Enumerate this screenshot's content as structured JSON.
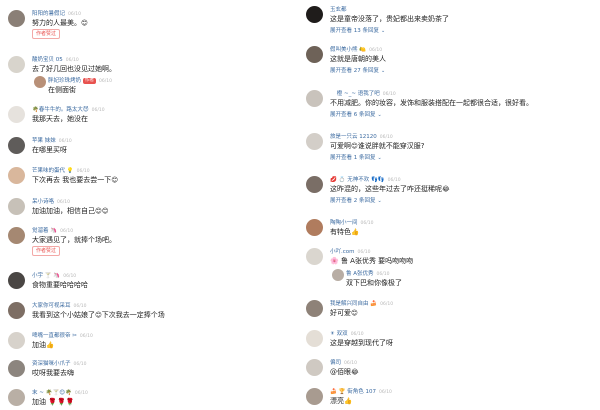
{
  "left": [
    {
      "name": "阳阳的暑假记",
      "time": "06/10",
      "text": "努力的人最美。",
      "emoji": "😊",
      "badge": "作者赞过",
      "avatar": "#8a7f76"
    },
    {
      "name": "酸奶宝贝 05",
      "time": "06/10",
      "text": "去了好几回也没见过她啊。",
      "avatar": "#d8d4cc",
      "reply": {
        "name": "胖妃珍珠烤奶",
        "tag": "作者",
        "time": "06/10",
        "text": "在侧面街",
        "avatar": "#b89078"
      }
    },
    {
      "name": "🌴春牛牛的。路太大😈",
      "time": "06/10",
      "text": "我那天去，她没在",
      "avatar": "#e6e2dd"
    },
    {
      "name": "苹果 妹妹",
      "time": "06/10",
      "text": "在哪里买呀",
      "avatar": "#5f5c5a"
    },
    {
      "name": "芒果味的蛋代 💡",
      "time": "06/10",
      "text": "下次再去 我也要去尝一下",
      "emoji": "😊",
      "avatar": "#d9b79c"
    },
    {
      "name": "呆小诗咯",
      "time": "06/10",
      "text": "加油加油，相信自己",
      "emoji": "😊😊",
      "avatar": "#c7c1b8"
    },
    {
      "name": "觉溜着 🦄",
      "time": "06/10",
      "text": "大家遇见了，就捧个场吧。",
      "badge": "作者赞过",
      "avatar": "#a58872"
    },
    {
      "name": "小宇 🍸 🦄",
      "time": "06/10",
      "text": "食物重要哈哈哈哈",
      "avatar": "#4a4644"
    },
    {
      "name": "大家你可视采耳",
      "time": "06/10",
      "text": "我看到这个小姑娘了",
      "emoji": "😊",
      "text2": "下次我去一定捧个场",
      "avatar": "#7d6e64"
    },
    {
      "name": "啤嘴一直都很帝 ✂",
      "time": "06/10",
      "text": "加油",
      "emoji": "👍",
      "avatar": "#d7d2cb"
    },
    {
      "name": "资深猫咪小爪子",
      "time": "06/10",
      "text": "哎呀我要去嗨",
      "avatar": "#8c857e"
    },
    {
      "name": "末 ~ 🌴🍸😊🌴",
      "time": "06/10",
      "text": "加油 🌹🌹🌹",
      "avatar": "#b9afa5"
    }
  ],
  "right": [
    {
      "name": "玉玄都",
      "time": "",
      "text": "这是童帝没落了，贵妃都出来卖奶茶了",
      "expand": "展开查看 13 条回复",
      "avatar": "#1f1c1b"
    },
    {
      "name": "假叫美小熊 🍋",
      "time": "06/10",
      "text": "这就是唐朝的美人",
      "expand": "展开查看 27 条回复",
      "avatar": "#6e6258"
    },
    {
      "name": "ㅤ 橙 ~_~ 语我了吧",
      "time": "06/10",
      "text": "不用减肥。你的妆容，发饰和服装搭配在一起都很合适，很好看。",
      "expand": "展开查看 6 条回复",
      "avatar": "#c9c3bc"
    },
    {
      "name": "旅是一只云 12120",
      "time": "06/10",
      "text": "可爱啊",
      "emoji": "😊",
      "text2": "谁说胖就不能穿汉服?",
      "expand": "展开查看 1 条回复",
      "avatar": "#d3cec8"
    },
    {
      "name": "💋 💍 无神不欢 👣👣",
      "time": "06/10",
      "text": "这昨混的，这些年过去了咋还挺稀呢",
      "emoji": "😂",
      "expand": "展开查看 2 条回复",
      "avatar": "#7a6e66"
    },
    {
      "name": "陶陶小一间",
      "time": "06/10",
      "text": "有特色",
      "emoji": "👍",
      "avatar": "#b07c5e"
    },
    {
      "name": "小吖.com",
      "time": "06/10",
      "text": "🌸 鲁 A张优秀  要吗吻吻吻",
      "avatar": "#dad6cf",
      "reply": {
        "name": "鲁 A张优秀",
        "tag": "",
        "time": "06/10",
        "text": "双下巴和你像极了",
        "avatar": "#b8ada4"
      }
    },
    {
      "name": "我是解兴同自由 🍰",
      "time": "06/10",
      "text": "好可爱",
      "emoji": "😊",
      "avatar": "#8e8278"
    },
    {
      "name": "☀ 双双",
      "time": "06/10",
      "text": "这是穿越到现代了呀",
      "avatar": "#e4ded6"
    },
    {
      "name": "偏司",
      "time": "06/10",
      "text": "@佰眼",
      "emoji": "😂",
      "avatar": "#cfc9c2"
    },
    {
      "name": "🍰 🏆 街角色 107",
      "time": "06/10",
      "text": "漂亮",
      "emoji": "👍",
      "avatar": "#a89b90"
    }
  ]
}
